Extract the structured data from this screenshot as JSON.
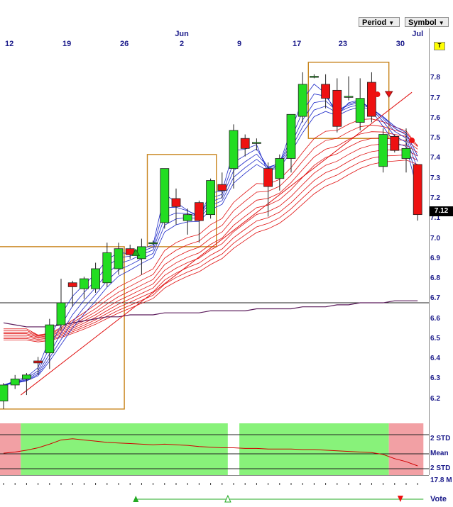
{
  "toolbar": {
    "period_label": "Period",
    "symbol_label": "Symbol",
    "t_label": "T"
  },
  "chart_data": {
    "type": "candlestick",
    "date_axis": [
      {
        "label": "12",
        "index": 0.5
      },
      {
        "label": "19",
        "index": 5.5
      },
      {
        "label": "26",
        "index": 10.5
      },
      {
        "label": "Jun",
        "index": 15.5,
        "major": true
      },
      {
        "label": "2",
        "index": 15.5
      },
      {
        "label": "9",
        "index": 20.5
      },
      {
        "label": "17",
        "index": 25.5
      },
      {
        "label": "23",
        "index": 29.5
      },
      {
        "label": "30",
        "index": 34.5
      },
      {
        "label": "Jul",
        "index": 36,
        "major": true
      }
    ],
    "ylim": [
      6.1,
      7.95
    ],
    "yticks": [
      6.2,
      6.3,
      6.4,
      6.5,
      6.6,
      6.7,
      6.8,
      6.9,
      7.0,
      7.1,
      7.2,
      7.3,
      7.4,
      7.5,
      7.6,
      7.7,
      7.8
    ],
    "last_price": "7.12",
    "candles": [
      {
        "o": 6.19,
        "h": 6.28,
        "l": 6.15,
        "c": 6.27
      },
      {
        "o": 6.27,
        "h": 6.32,
        "l": 6.25,
        "c": 6.3
      },
      {
        "o": 6.3,
        "h": 6.33,
        "l": 6.22,
        "c": 6.32
      },
      {
        "o": 6.39,
        "h": 6.41,
        "l": 6.32,
        "c": 6.38
      },
      {
        "o": 6.43,
        "h": 6.6,
        "l": 6.35,
        "c": 6.57
      },
      {
        "o": 6.57,
        "h": 6.8,
        "l": 6.54,
        "c": 6.68
      },
      {
        "o": 6.78,
        "h": 6.79,
        "l": 6.66,
        "c": 6.76
      },
      {
        "o": 6.75,
        "h": 6.81,
        "l": 6.7,
        "c": 6.8
      },
      {
        "o": 6.75,
        "h": 6.88,
        "l": 6.73,
        "c": 6.85
      },
      {
        "o": 6.78,
        "h": 6.98,
        "l": 6.76,
        "c": 6.93
      },
      {
        "o": 6.85,
        "h": 6.98,
        "l": 6.82,
        "c": 6.95
      },
      {
        "o": 6.95,
        "h": 6.97,
        "l": 6.9,
        "c": 6.92
      },
      {
        "o": 6.9,
        "h": 7.0,
        "l": 6.82,
        "c": 6.96
      },
      {
        "o": 6.98,
        "h": 6.99,
        "l": 6.97,
        "c": 6.98
      },
      {
        "o": 7.08,
        "h": 7.35,
        "l": 7.05,
        "c": 7.35
      },
      {
        "o": 7.2,
        "h": 7.25,
        "l": 7.07,
        "c": 7.16
      },
      {
        "o": 7.09,
        "h": 7.15,
        "l": 7.02,
        "c": 7.12
      },
      {
        "o": 7.18,
        "h": 7.19,
        "l": 6.98,
        "c": 7.09
      },
      {
        "o": 7.12,
        "h": 7.3,
        "l": 7.1,
        "c": 7.29
      },
      {
        "o": 7.27,
        "h": 7.33,
        "l": 7.2,
        "c": 7.24
      },
      {
        "o": 7.35,
        "h": 7.57,
        "l": 7.25,
        "c": 7.54
      },
      {
        "o": 7.5,
        "h": 7.52,
        "l": 7.41,
        "c": 7.45
      },
      {
        "o": 7.48,
        "h": 7.5,
        "l": 7.44,
        "c": 7.48
      },
      {
        "o": 7.35,
        "h": 7.38,
        "l": 7.11,
        "c": 7.26
      },
      {
        "o": 7.3,
        "h": 7.42,
        "l": 7.24,
        "c": 7.4
      },
      {
        "o": 7.4,
        "h": 7.62,
        "l": 7.33,
        "c": 7.62
      },
      {
        "o": 7.61,
        "h": 7.83,
        "l": 7.58,
        "c": 7.77
      },
      {
        "o": 7.81,
        "h": 7.82,
        "l": 7.8,
        "c": 7.81
      },
      {
        "o": 7.77,
        "h": 7.82,
        "l": 7.65,
        "c": 7.7
      },
      {
        "o": 7.74,
        "h": 7.8,
        "l": 7.53,
        "c": 7.56
      },
      {
        "o": 7.71,
        "h": 7.81,
        "l": 7.69,
        "c": 7.71
      },
      {
        "o": 7.58,
        "h": 7.8,
        "l": 7.54,
        "c": 7.7
      },
      {
        "o": 7.78,
        "h": 7.83,
        "l": 7.58,
        "c": 7.61
      },
      {
        "o": 7.36,
        "h": 7.55,
        "l": 7.33,
        "c": 7.52
      },
      {
        "o": 7.51,
        "h": 7.52,
        "l": 7.43,
        "c": 7.44
      },
      {
        "o": 7.4,
        "h": 7.55,
        "l": 7.33,
        "c": 7.45
      },
      {
        "o": 7.37,
        "h": 7.37,
        "l": 7.09,
        "c": 7.12
      }
    ],
    "boxes": [
      {
        "from": -0.5,
        "to": 10.5,
        "top": 6.96,
        "bottom": 6.15
      },
      {
        "from": 12.5,
        "to": 18.5,
        "top": 7.42,
        "bottom": 6.96
      },
      {
        "from": 26.5,
        "to": 33.5,
        "top": 7.88,
        "bottom": 7.5
      }
    ],
    "trend_lines": [
      {
        "from": [
          1.5,
          6.22
        ],
        "to": [
          35.5,
          7.73
        ]
      }
    ],
    "horizontal_line": 6.68,
    "signals": [
      {
        "index": 11.5,
        "type": "up-arrow",
        "value": 6.93
      },
      {
        "index": 32.5,
        "type": "dot",
        "value": 7.72
      },
      {
        "index": 33.5,
        "type": "down-arrow",
        "value": 7.72
      },
      {
        "index": 35.5,
        "type": "dot",
        "value": 7.49
      }
    ],
    "ma_slow": [
      6.58,
      6.57,
      6.56,
      6.56,
      6.56,
      6.57,
      6.58,
      6.59,
      6.6,
      6.61,
      6.61,
      6.62,
      6.62,
      6.62,
      6.63,
      6.63,
      6.63,
      6.63,
      6.64,
      6.64,
      6.64,
      6.64,
      6.65,
      6.65,
      6.65,
      6.65,
      6.66,
      6.66,
      6.66,
      6.67,
      6.67,
      6.68,
      6.68,
      6.68,
      6.69,
      6.69,
      6.69
    ],
    "osc": {
      "labels": [
        "2 STD",
        "Mean",
        "2 STD"
      ],
      "zones": [
        {
          "from": -0.5,
          "to": 1.5,
          "color": "red"
        },
        {
          "from": 1.5,
          "to": 19.5,
          "color": "green"
        },
        {
          "from": 19.5,
          "to": 20.5,
          "color": "white"
        },
        {
          "from": 20.5,
          "to": 33.5,
          "color": "green"
        },
        {
          "from": 33.5,
          "to": 36.5,
          "color": "red"
        }
      ],
      "values": [
        0.1,
        0.3,
        0.6,
        1.0,
        1.6,
        2.3,
        2.5,
        2.3,
        2.1,
        1.9,
        1.8,
        1.7,
        1.6,
        1.5,
        1.6,
        1.5,
        1.4,
        1.2,
        1.1,
        1.0,
        1.0,
        0.9,
        0.9,
        0.8,
        0.8,
        0.8,
        0.7,
        0.7,
        0.6,
        0.5,
        0.4,
        0.3,
        0.2,
        -0.1,
        -0.8,
        -1.3,
        -2.0
      ]
    },
    "volume_label": "17.8 M",
    "vote": {
      "label": "Vote",
      "marks": [
        {
          "index": 11.5,
          "type": "up-filled"
        },
        {
          "index": 19.5,
          "type": "up-outline"
        },
        {
          "index": 34.5,
          "type": "down-filled"
        }
      ]
    }
  }
}
